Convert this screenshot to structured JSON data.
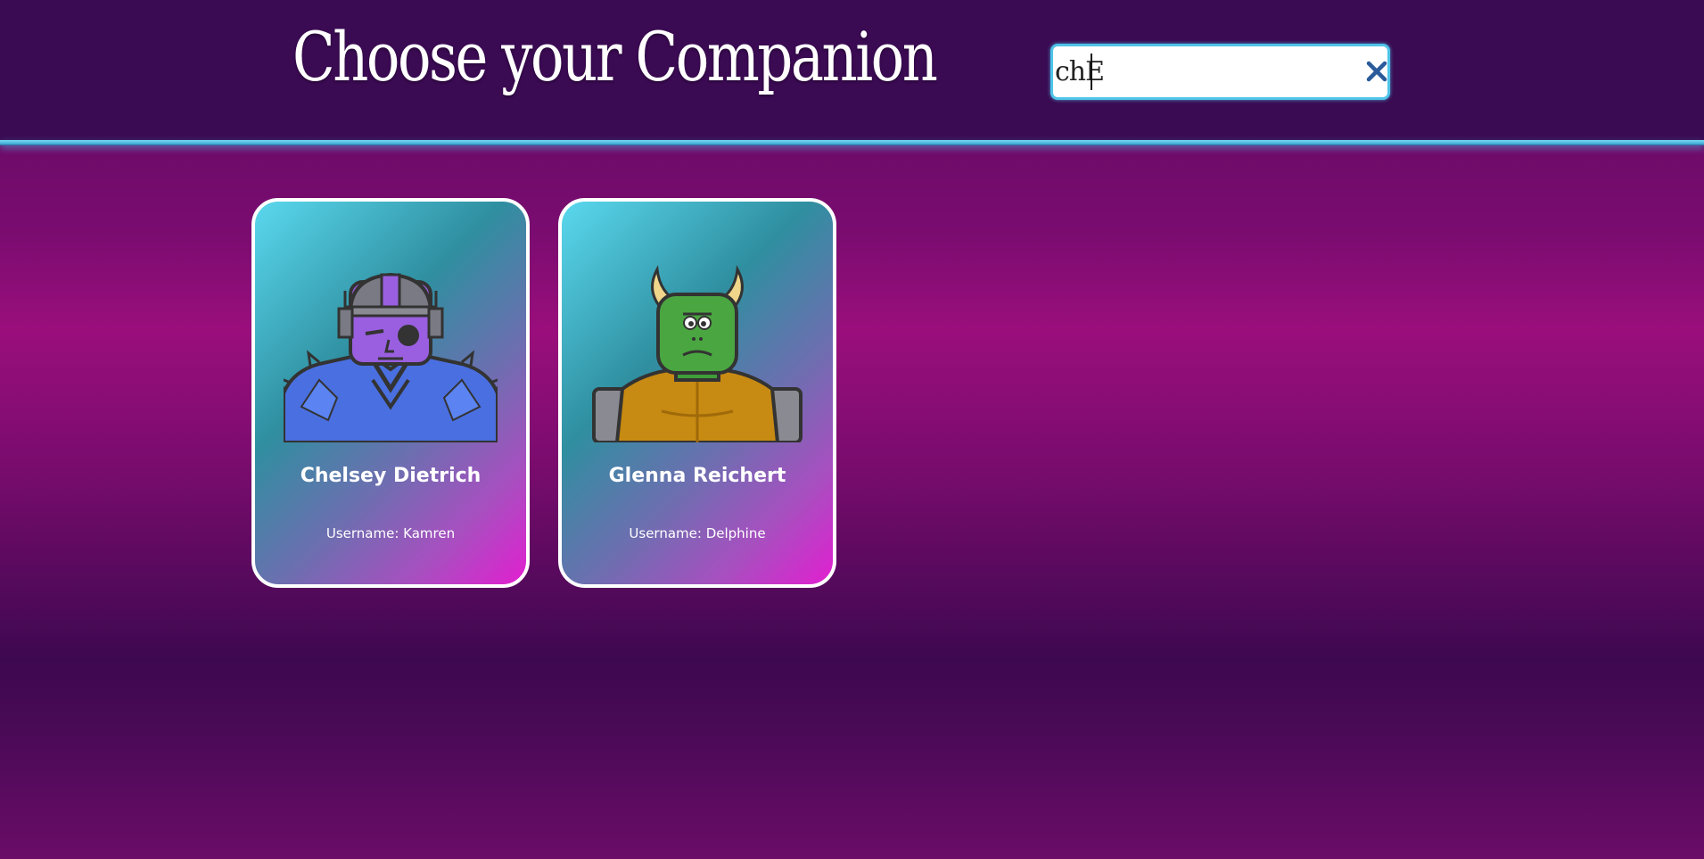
{
  "header": {
    "title": "Choose your Companion",
    "search": {
      "value": "chE",
      "placeholder": "",
      "clear_icon": "close-icon"
    }
  },
  "cards": [
    {
      "name": "Chelsey Dietrich",
      "username_label": "Username: Kamren",
      "avatar_icon": "robot-avatar-icon"
    },
    {
      "name": "Glenna Reichert",
      "username_label": "Username: Delphine",
      "avatar_icon": "monster-avatar-icon"
    }
  ],
  "colors": {
    "header_bg": "#3a0a52",
    "header_border": "#4fc3e8",
    "card_border": "#ffffff",
    "clear_icon": "#2a5a9a"
  }
}
